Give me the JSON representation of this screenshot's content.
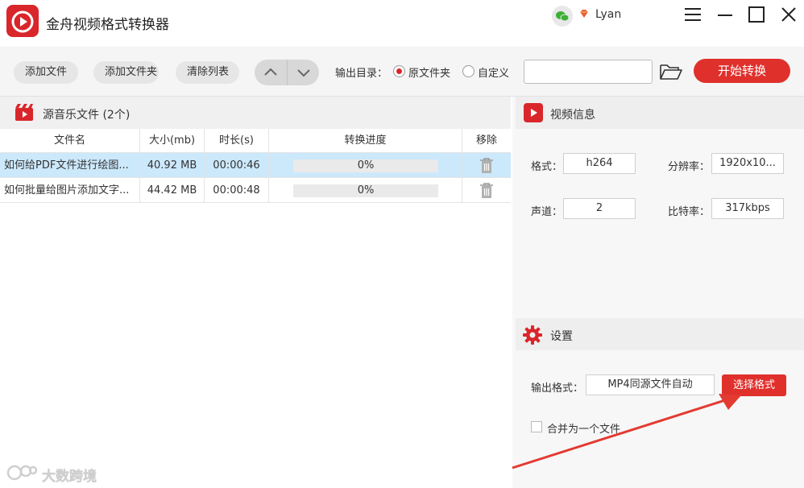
{
  "window": {
    "title": "金舟视频格式转换器",
    "user_name": "Lyan"
  },
  "toolbar": {
    "add_file": "添加文件",
    "add_folder": "添加文件夹",
    "clear_list": "清除列表",
    "output_dir_label": "输出目录：",
    "radio_original": "原文件夹",
    "radio_custom": "自定义",
    "output_path_value": "",
    "start_convert": "开始转换"
  },
  "file_list": {
    "title": "源音乐文件 (2个)",
    "columns": [
      "文件名",
      "大小(mb)",
      "时长(s)",
      "转换进度",
      "移除"
    ],
    "rows": [
      {
        "name": "如何给PDF文件进行绘图...",
        "size": "40.92 MB",
        "duration": "00:00:46",
        "progress": "0%",
        "progress_value": 0,
        "selected": true
      },
      {
        "name": "如何批量给图片添加文字...",
        "size": "44.42 MB",
        "duration": "00:00:48",
        "progress": "0%",
        "progress_value": 0,
        "selected": false
      }
    ]
  },
  "video_info": {
    "title": "视频信息",
    "format_label": "格式：",
    "format_value": "h264",
    "resolution_label": "分辨率：",
    "resolution_value": "1920x10...",
    "channels_label": "声道：",
    "channels_value": "2",
    "bitrate_label": "比特率：",
    "bitrate_value": "317kbps"
  },
  "settings": {
    "title": "设置",
    "output_format_label": "输出格式：",
    "output_format_value": "MP4同源文件自动",
    "choose_format": "选择格式",
    "merge_label": "合并为一个文件",
    "merge_checked": false
  },
  "watermark": {
    "text": "大数跨境"
  },
  "colors": {
    "accent": "#e0302c",
    "selected_row": "#cce8fb",
    "panel_header": "#eeeeee"
  },
  "icons": [
    "app-logo-icon",
    "wechat-icon",
    "vip-diamond-icon",
    "menu-icon",
    "minimize-icon",
    "maximize-icon",
    "close-icon",
    "chevron-up-icon",
    "chevron-down-icon",
    "folder-icon",
    "film-icon",
    "trash-icon",
    "play-icon",
    "gear-icon"
  ]
}
